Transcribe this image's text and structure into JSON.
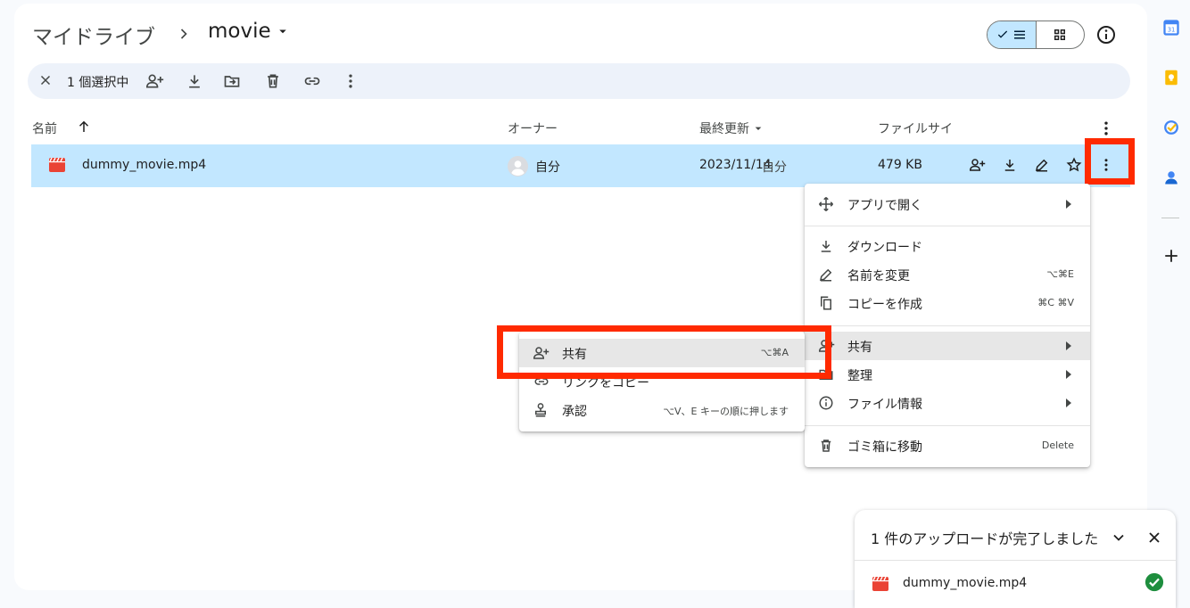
{
  "header": {
    "root_label": "マイドライブ",
    "current_folder": "movie"
  },
  "selection_bar": {
    "count_label": "1 個選択中"
  },
  "columns": {
    "name": "名前",
    "owner": "オーナー",
    "modified": "最終更新",
    "size": "ファイルサイ"
  },
  "file_row": {
    "name": "dummy_movie.mp4",
    "owner": "自分",
    "modified_date": "2023/11/14",
    "modified_by": "自分",
    "size": "479 KB"
  },
  "context_menu": {
    "open_with": "アプリで開く",
    "download": "ダウンロード",
    "rename": "名前を変更",
    "rename_shortcut": "⌥⌘E",
    "copy": "コピーを作成",
    "copy_shortcut": "⌘C ⌘V",
    "share": "共有",
    "organize": "整理",
    "file_info": "ファイル情報",
    "trash": "ゴミ箱に移動",
    "trash_shortcut": "Delete"
  },
  "share_submenu": {
    "share": "共有",
    "share_shortcut": "⌥⌘A",
    "copy_link": "リンクをコピー",
    "approve": "承認",
    "approve_shortcut": "⌥V、E キーの順に押します"
  },
  "upload_panel": {
    "title": "1 件のアップロードが完了しました",
    "file_name": "dummy_movie.mp4"
  },
  "colors": {
    "selected_row": "#c2e7ff",
    "highlight": "#ff2a00",
    "video_icon": "#ea4335",
    "success": "#1e8e3e"
  }
}
